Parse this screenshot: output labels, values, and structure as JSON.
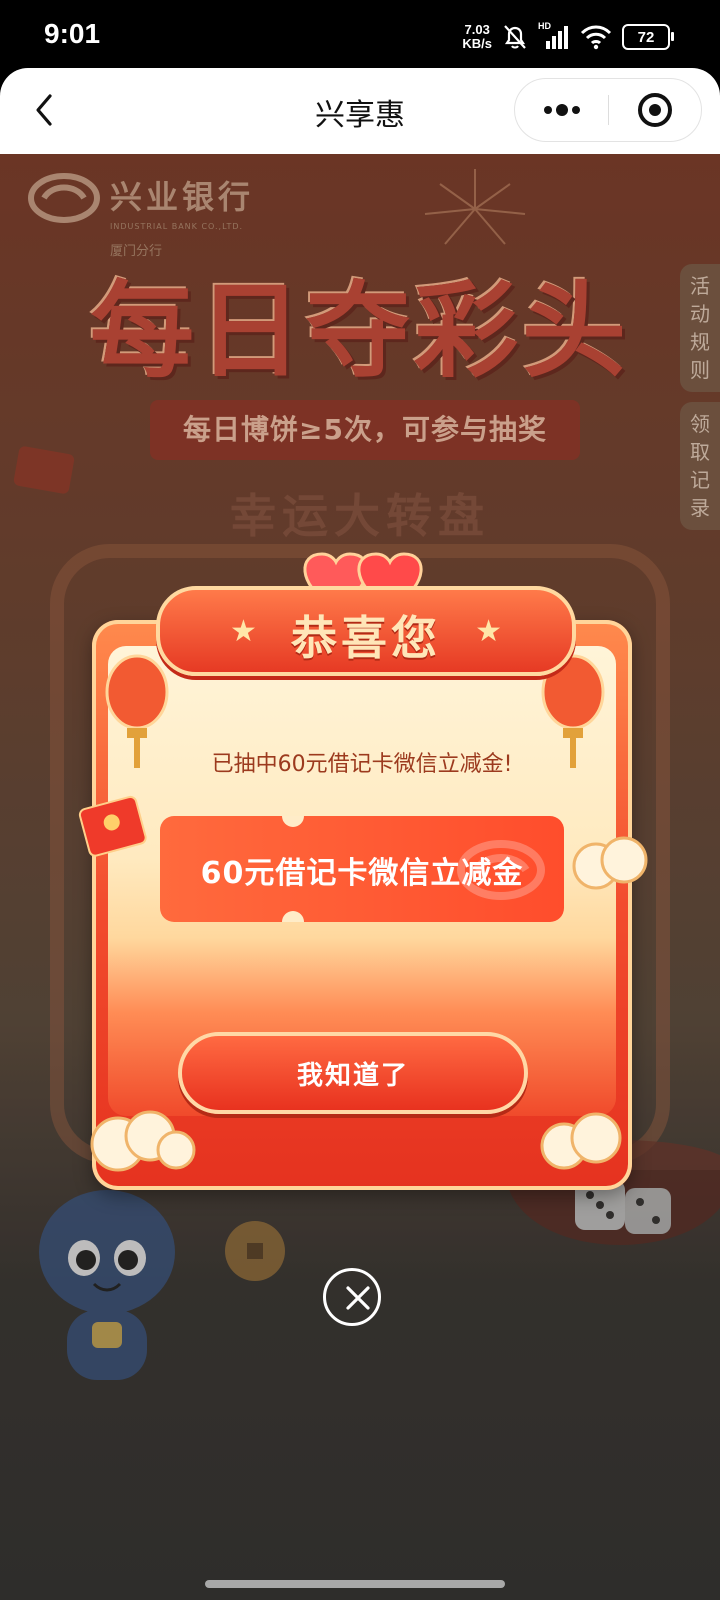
{
  "status_bar": {
    "time": "9:01",
    "net_speed_value": "7.03",
    "net_speed_unit": "KB/s",
    "network_badge": "HD",
    "battery": "72"
  },
  "nav": {
    "title": "兴享惠",
    "back_icon": "chevron-left-icon",
    "more_icon": "more-dots-icon",
    "close_icon": "target-circle-icon"
  },
  "background": {
    "bank_name": "兴业银行",
    "bank_name_en": "INDUSTRIAL BANK CO.,LTD.",
    "branch": "厦门分行",
    "headline": "每日夺彩头",
    "ribbon": "每日博饼≥5次，可参与抽奖",
    "wheel_title": "幸运大转盘",
    "side_tabs": [
      {
        "label": "活动规则"
      },
      {
        "label": "领取记录"
      }
    ]
  },
  "modal": {
    "title": "恭喜您",
    "message": "已抽中60元借记卡微信立减金!",
    "prize_name": "60元借记卡微信立减金",
    "button_label": "我知道了"
  },
  "colors": {
    "accent_red": "#e8321f",
    "gold": "#ffd9a0",
    "text_brown": "#9c3a1e"
  }
}
